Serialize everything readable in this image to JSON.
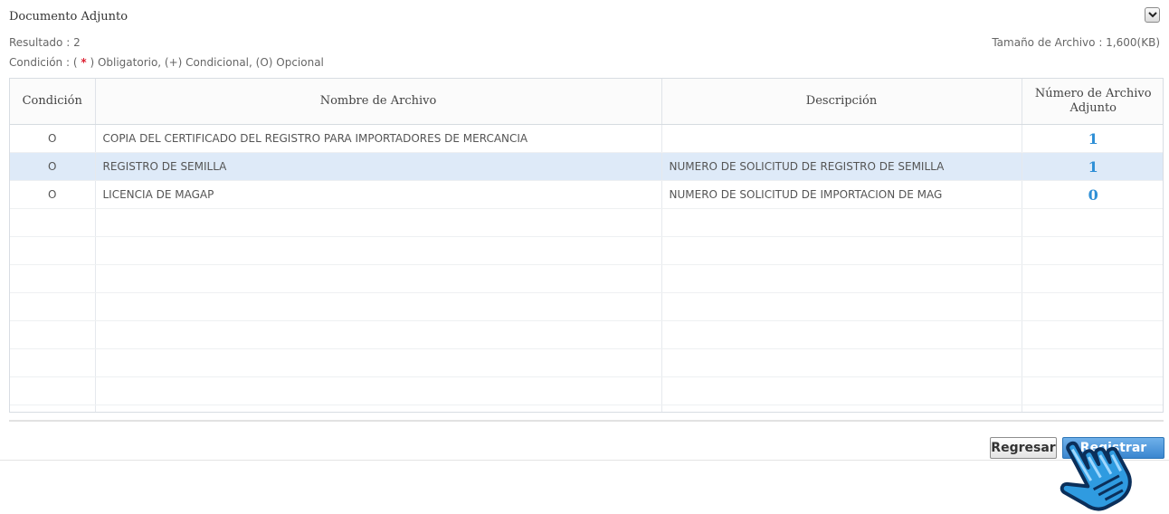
{
  "section": {
    "title": "Documento Adjunto",
    "result": "Resultado : 2",
    "file_size": "Tamaño de Archivo : 1,600(KB)",
    "condition_prefix": "Condición : (",
    "condition_star": "*",
    "condition_suffix": ") Obligatorio, (+) Condicional, (O) Opcional"
  },
  "table": {
    "headers": {
      "condition": "Condición",
      "file_name": "Nombre de Archivo",
      "description": "Descripción",
      "attachment_count": "Número de Archivo Adjunto"
    },
    "rows": [
      {
        "condition": "O",
        "file_name": "COPIA DEL CERTIFICADO DEL REGISTRO PARA IMPORTADORES DE MERCANCIA",
        "description": "",
        "count": "1"
      },
      {
        "condition": "O",
        "file_name": "REGISTRO DE SEMILLA",
        "description": "NUMERO DE SOLICITUD DE REGISTRO DE SEMILLA",
        "count": "1"
      },
      {
        "condition": "O",
        "file_name": "LICENCIA DE MAGAP",
        "description": "NUMERO DE SOLICITUD DE IMPORTACION DE MAG",
        "count": "0"
      }
    ]
  },
  "buttons": {
    "back": "Regresar",
    "register": "Registrar"
  },
  "colors": {
    "selected_row": "#deeaf8",
    "count_text": "#2e8fd6",
    "register_button": "#3a86cf"
  }
}
